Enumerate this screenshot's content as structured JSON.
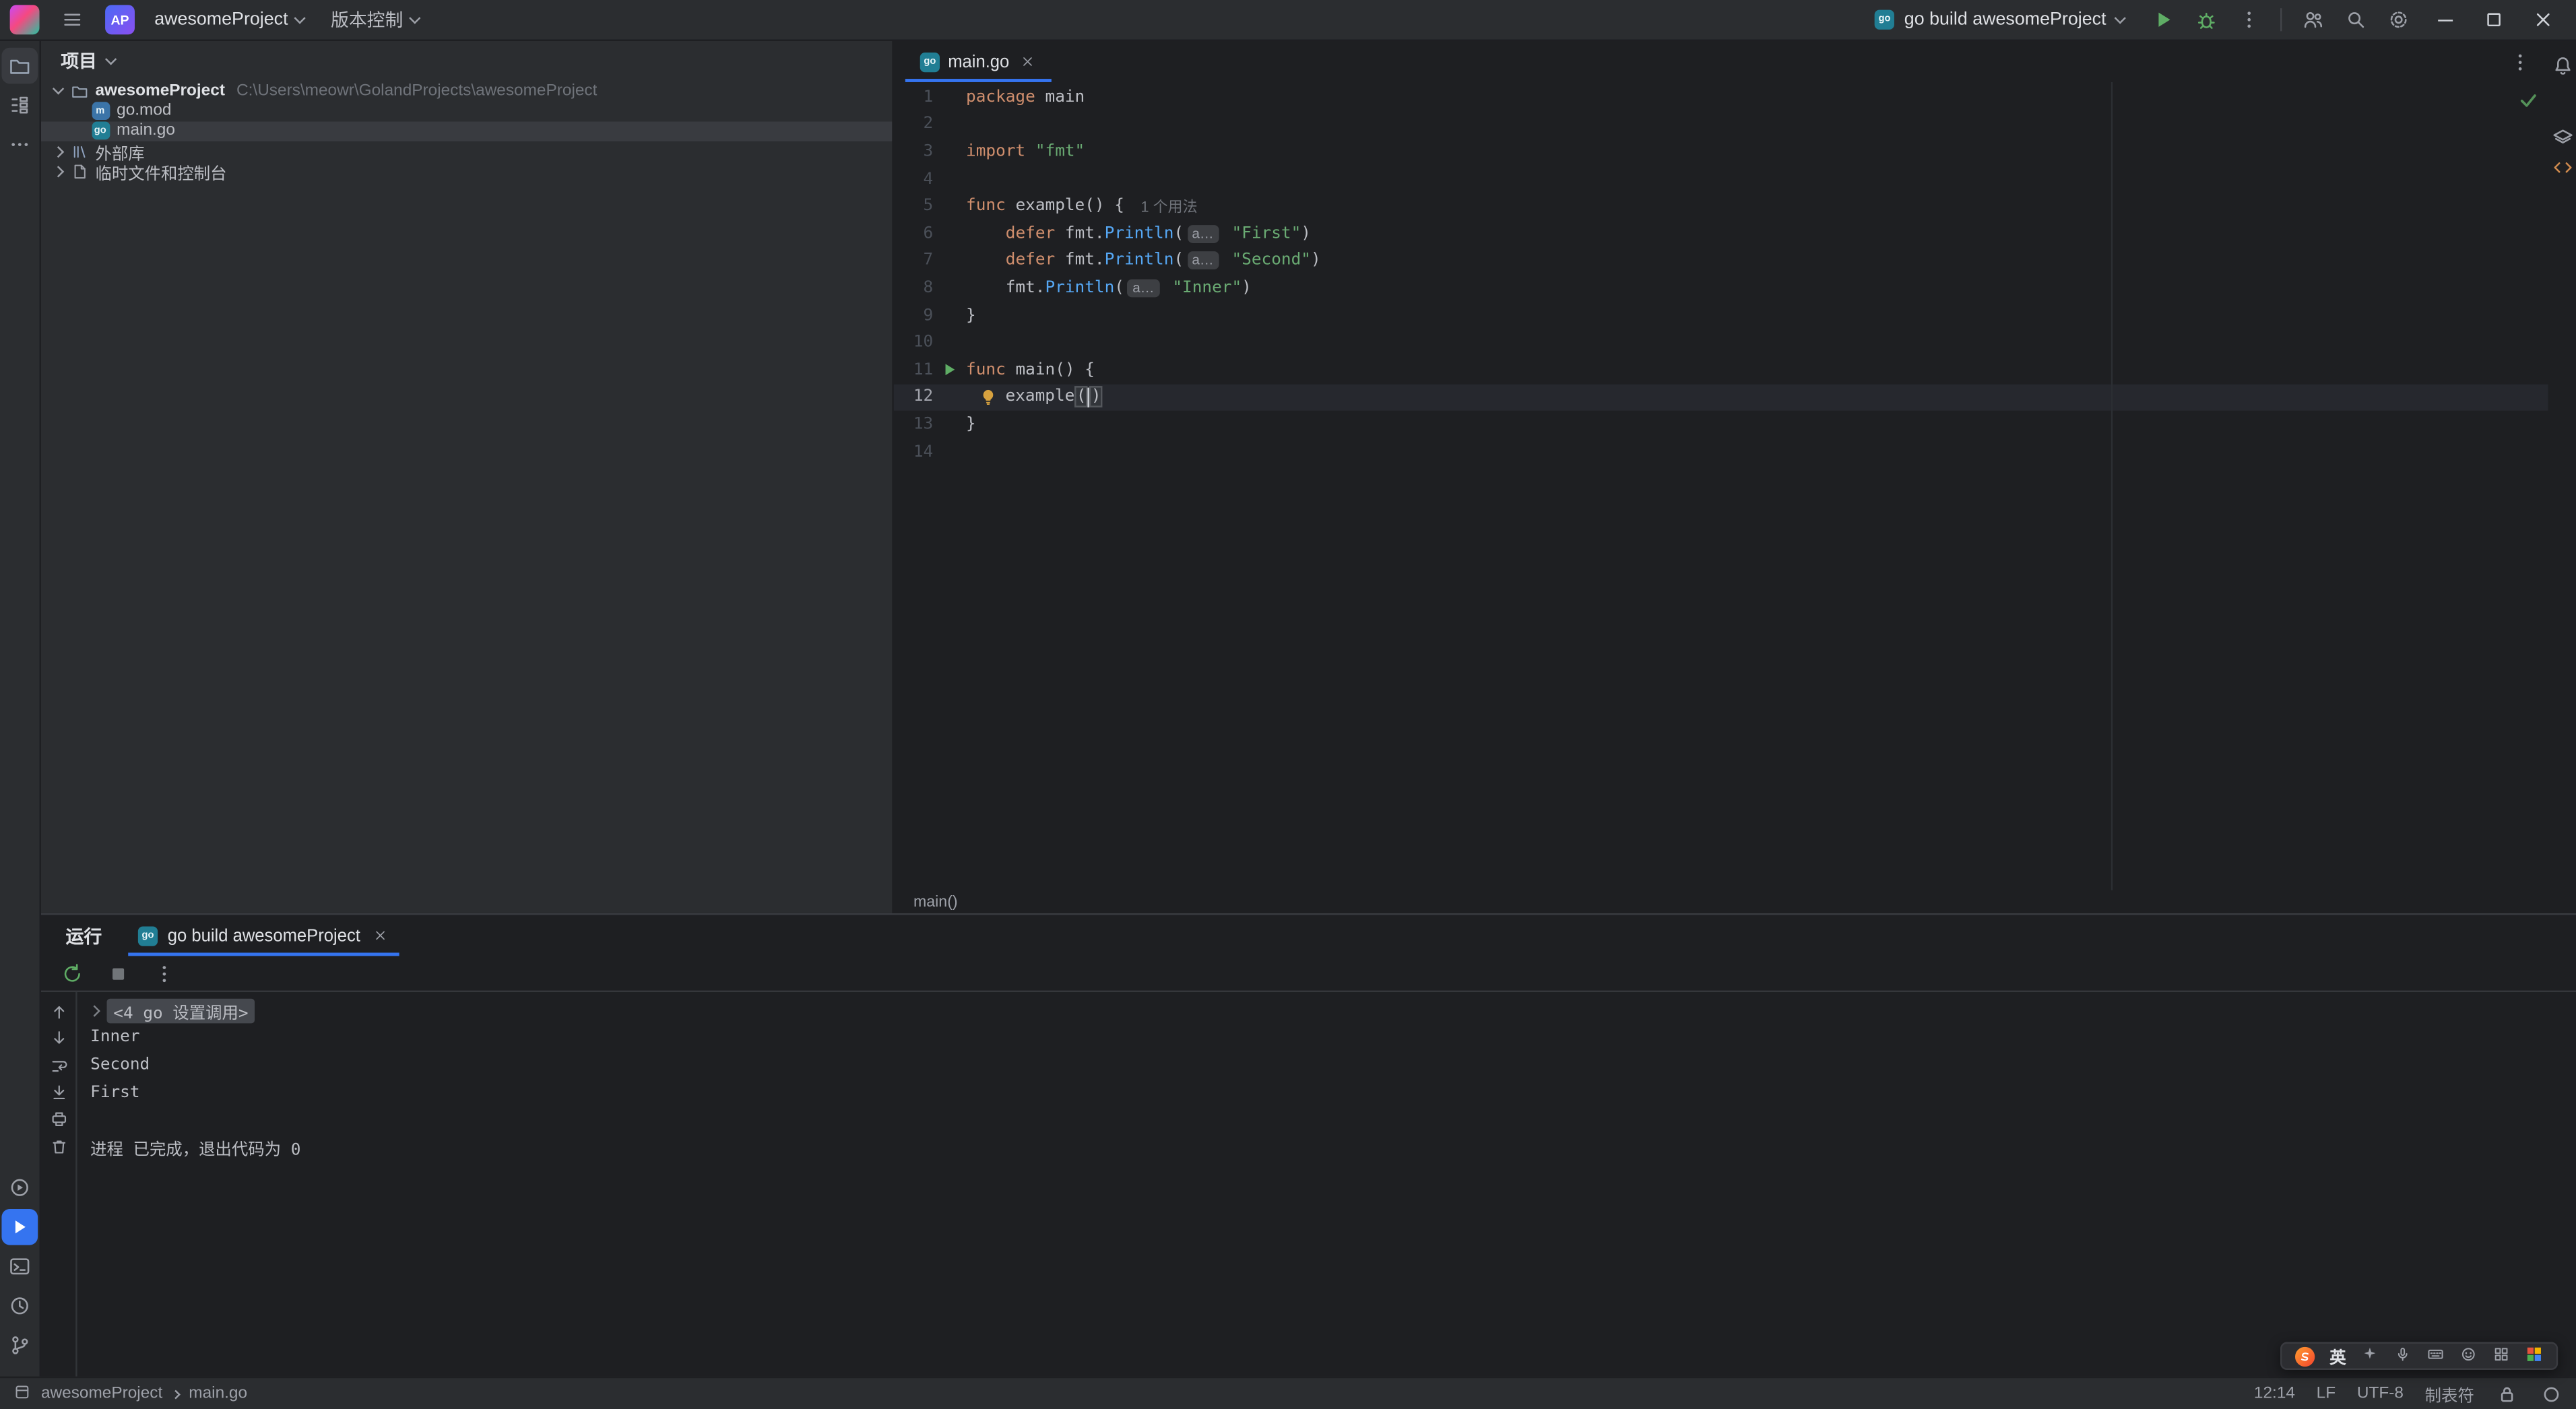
{
  "colors": {
    "accent_blue": "#3574f0",
    "panel_bg": "#2b2d30",
    "editor_bg": "#1e1f22",
    "selection_bg": "#393b40",
    "keyword": "#cf8e6d",
    "string": "#6aab73",
    "function_call": "#56a8f5",
    "run_green": "#5fad65",
    "text_primary": "#dfe1e5",
    "text_secondary": "#9da0a8"
  },
  "titlebar": {
    "project_badge": "AP",
    "project_name": "awesomeProject",
    "vcs_label": "版本控制",
    "run_config_label": "go build awesomeProject"
  },
  "project_panel": {
    "title": "项目",
    "root_name": "awesomeProject",
    "root_path": "C:\\Users\\meowr\\GolandProjects\\awesomeProject",
    "file_gomod": "go.mod",
    "file_maingo": "main.go",
    "external_libraries": "外部库",
    "scratches": "临时文件和控制台"
  },
  "editor": {
    "tab_label": "main.go",
    "breadcrumb": "main()",
    "go_badge": "go",
    "code": [
      {
        "n": 1,
        "tokens": [
          [
            "kw",
            "package"
          ],
          [
            "tx",
            " main"
          ]
        ]
      },
      {
        "n": 2,
        "tokens": []
      },
      {
        "n": 3,
        "tokens": [
          [
            "kw",
            "import"
          ],
          [
            "tx",
            " "
          ],
          [
            "str",
            "\"fmt\""
          ]
        ]
      },
      {
        "n": 4,
        "tokens": []
      },
      {
        "n": 5,
        "tokens": [
          [
            "kw",
            "func"
          ],
          [
            "tx",
            " example() {"
          ],
          [
            "hint",
            "1 个用法"
          ]
        ]
      },
      {
        "n": 6,
        "tokens": [
          [
            "tx",
            "    "
          ],
          [
            "kw",
            "defer"
          ],
          [
            "tx",
            " fmt."
          ],
          [
            "fn",
            "Println"
          ],
          [
            "tx",
            "("
          ],
          [
            "badge",
            "a…"
          ],
          [
            "str",
            " \"First\""
          ],
          [
            "tx",
            ")"
          ]
        ]
      },
      {
        "n": 7,
        "tokens": [
          [
            "tx",
            "    "
          ],
          [
            "kw",
            "defer"
          ],
          [
            "tx",
            " fmt."
          ],
          [
            "fn",
            "Println"
          ],
          [
            "tx",
            "("
          ],
          [
            "badge",
            "a…"
          ],
          [
            "str",
            " \"Second\""
          ],
          [
            "tx",
            ")"
          ]
        ]
      },
      {
        "n": 8,
        "tokens": [
          [
            "tx",
            "    fmt."
          ],
          [
            "fn",
            "Println"
          ],
          [
            "tx",
            "("
          ],
          [
            "badge",
            "a…"
          ],
          [
            "str",
            " \"Inner\""
          ],
          [
            "tx",
            ")"
          ]
        ]
      },
      {
        "n": 9,
        "tokens": [
          [
            "tx",
            "}"
          ]
        ]
      },
      {
        "n": 10,
        "tokens": []
      },
      {
        "n": 11,
        "gutter": "run",
        "tokens": [
          [
            "kw",
            "func"
          ],
          [
            "tx",
            " main() {"
          ]
        ]
      },
      {
        "n": 12,
        "current": true,
        "tokens": [
          [
            "bulb",
            ""
          ],
          [
            "tx",
            "example"
          ],
          [
            "paren",
            "("
          ],
          [
            "caret",
            ""
          ],
          [
            "paren",
            ")"
          ]
        ]
      },
      {
        "n": 13,
        "tokens": [
          [
            "tx",
            "}"
          ]
        ]
      },
      {
        "n": 14,
        "tokens": []
      }
    ]
  },
  "run_panel": {
    "tool_label": "运行",
    "tab_label": "go build awesomeProject",
    "console": [
      {
        "type": "fold",
        "text": "<4 go 设置调用>"
      },
      {
        "type": "out",
        "text": "Inner"
      },
      {
        "type": "out",
        "text": "Second"
      },
      {
        "type": "out",
        "text": "First"
      },
      {
        "type": "blank",
        "text": ""
      },
      {
        "type": "exit",
        "text": "进程 已完成，退出代码为 0"
      }
    ]
  },
  "statusbar": {
    "crumb_project": "awesomeProject",
    "crumb_file": "main.go",
    "caret_position": "12:14",
    "line_separator": "LF",
    "encoding": "UTF-8",
    "indent_style": "制表符"
  },
  "ime_bar": {
    "language": "英"
  }
}
